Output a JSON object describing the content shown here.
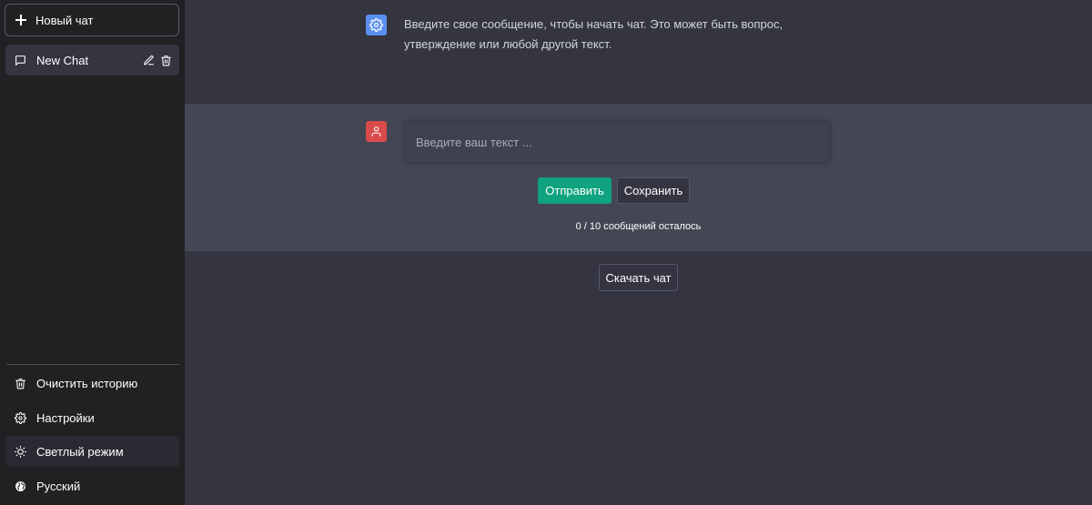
{
  "sidebar": {
    "new_chat_label": "Новый чат",
    "chats": [
      {
        "label": "New Chat"
      }
    ],
    "menu": {
      "clear_history": "Очистить историю",
      "settings": "Настройки",
      "light_mode": "Светлый режим",
      "language": "Русский"
    }
  },
  "conversation": {
    "assistant_message": "Введите свое сообщение, чтобы начать чат. Это может быть вопрос, утверждение или любой другой текст.",
    "input_placeholder": "Введите ваш текст ...",
    "send_label": "Отправить",
    "save_label": "Сохранить",
    "counter_text": "0 / 10 сообщений осталось",
    "download_label": "Скачать чат"
  },
  "colors": {
    "sidebar_bg": "#202123",
    "main_bg": "#343541",
    "user_block_bg": "#444654",
    "accent_green": "#10a37f",
    "bot_avatar": "#5b8ff0",
    "user_avatar": "#d94a4a"
  },
  "icons": {
    "new_chat": "plus-icon",
    "chat": "chat-bubble-icon",
    "edit": "pencil-icon",
    "delete": "trash-icon",
    "clear_history": "trash-icon",
    "settings": "gear-icon",
    "light_mode": "sun-icon",
    "language": "globe-icon",
    "bot_avatar": "gear-icon",
    "user_avatar": "user-icon"
  }
}
